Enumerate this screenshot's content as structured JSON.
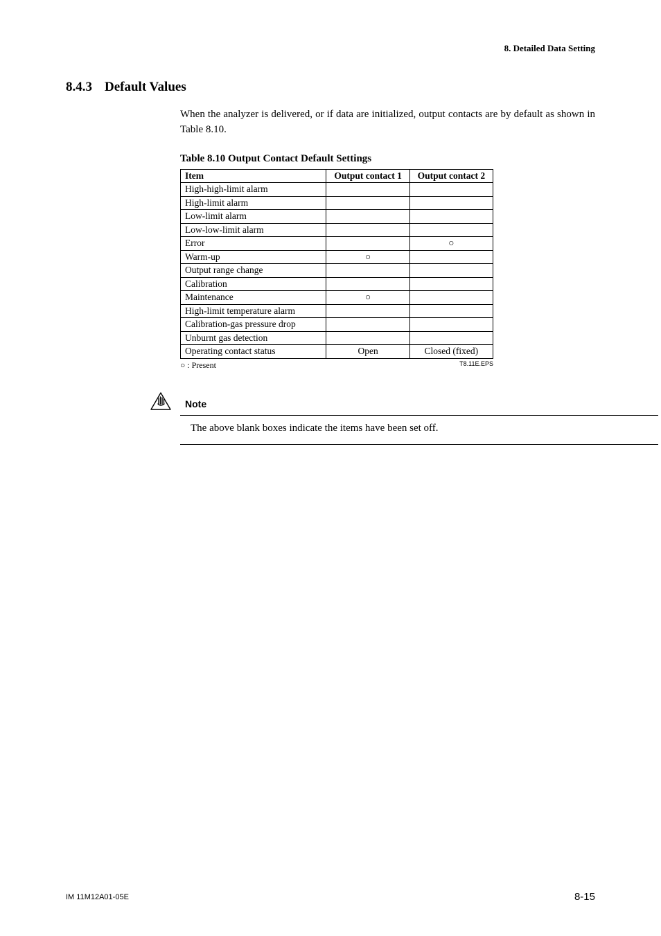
{
  "header": {
    "breadcrumb": "8.  Detailed Data Setting"
  },
  "section": {
    "number": "8.4.3",
    "title": "Default Values",
    "paragraph": "When the analyzer is delivered, or if data are initialized, output contacts are by default as shown in Table 8.10."
  },
  "table": {
    "caption": "Table 8.10 Output Contact Default Settings",
    "headers": {
      "item": "Item",
      "c1": "Output contact 1",
      "c2": "Output contact 2"
    },
    "rows": [
      {
        "item": "High-high-limit alarm",
        "c1": "",
        "c2": ""
      },
      {
        "item": "High-limit alarm",
        "c1": "",
        "c2": ""
      },
      {
        "item": "Low-limit alarm",
        "c1": "",
        "c2": ""
      },
      {
        "item": "Low-low-limit  alarm",
        "c1": "",
        "c2": ""
      },
      {
        "item": "Error",
        "c1": "",
        "c2": "○"
      },
      {
        "item": "Warm-up",
        "c1": "○",
        "c2": ""
      },
      {
        "item": "Output range change",
        "c1": "",
        "c2": ""
      },
      {
        "item": "Calibration",
        "c1": "",
        "c2": ""
      },
      {
        "item": "Maintenance",
        "c1": "○",
        "c2": ""
      },
      {
        "item": "High-limit temperature alarm",
        "c1": "",
        "c2": ""
      },
      {
        "item": "Calibration-gas pressure drop",
        "c1": "",
        "c2": ""
      },
      {
        "item": "Unburnt gas detection",
        "c1": "",
        "c2": ""
      },
      {
        "item": "Operating contact status",
        "c1": "Open",
        "c2": "Closed (fixed)"
      }
    ],
    "legend": "○ :  Present",
    "eps": "T8.11E.EPS"
  },
  "note": {
    "label": "Note",
    "text": "The above blank boxes indicate the items have been set off."
  },
  "footer": {
    "doc_id": "IM 11M12A01-05E",
    "page_number": "8-15"
  }
}
